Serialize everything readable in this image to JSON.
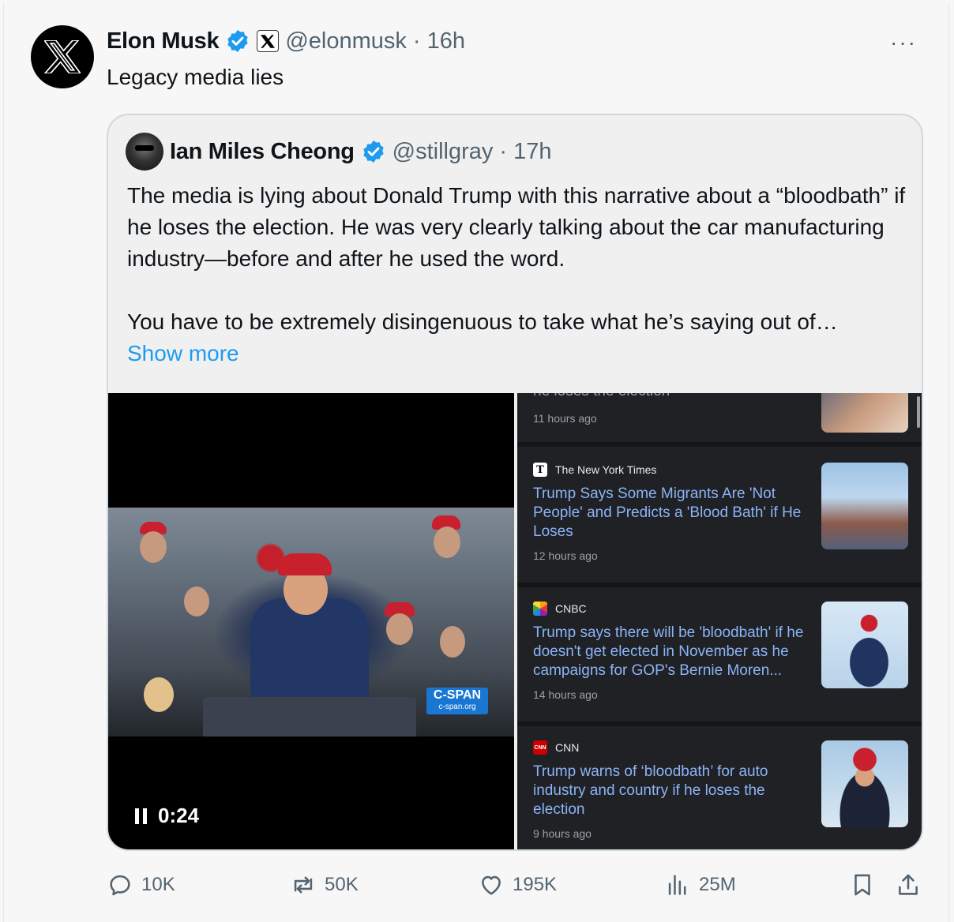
{
  "tweet": {
    "author_name": "Elon Musk",
    "author_handle": "@elonmusk",
    "separator": "·",
    "time": "16h",
    "text": "Legacy media lies",
    "more_label": "···"
  },
  "quote": {
    "author_name": "Ian Miles Cheong",
    "author_handle": "@stillgray",
    "separator": "·",
    "time": "17h",
    "paragraph1": "The media is lying about Donald Trump with this narrative about a “bloodbath” if he loses the election. He was very clearly talking about the car manufacturing industry—before and after he used the word.",
    "paragraph2": "You have to be extremely disingenuous to take what he’s saying out of…",
    "show_more": "Show more"
  },
  "video": {
    "duration": "0:24",
    "badge_top": "C-SPAN",
    "badge_bottom": "c-span.org"
  },
  "news": {
    "partial_headline": "he loses the election",
    "partial_time": "11 hours ago",
    "articles": [
      {
        "source": "The New York Times",
        "headline": "Trump Says Some Migrants Are 'Not People' and Predicts a 'Blood Bath' if He Loses",
        "time": "12 hours ago"
      },
      {
        "source": "CNBC",
        "headline": "Trump says there will be 'bloodbath' if he doesn't get elected in November as he campaigns for GOP's Bernie Moren...",
        "time": "14 hours ago"
      },
      {
        "source": "CNN",
        "headline": "Trump warns of ‘bloodbath’ for auto industry and country if he loses the election",
        "time": "9 hours ago"
      }
    ]
  },
  "actions": {
    "replies": "10K",
    "reposts": "50K",
    "likes": "195K",
    "views": "25M"
  },
  "colors": {
    "verified": "#1d9bf0",
    "link": "#1d9bf0",
    "news_link": "#8ab4f8",
    "secondary_text": "#536471"
  }
}
